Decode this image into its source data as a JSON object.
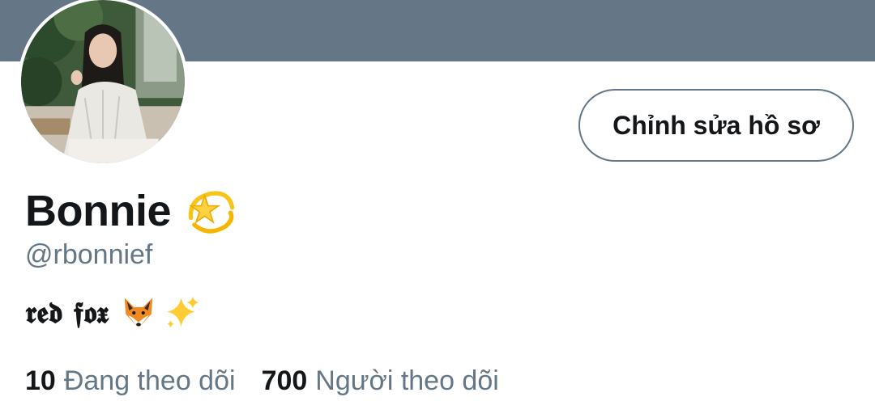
{
  "profile": {
    "display_name": "Bonnie",
    "handle": "@rbonnief",
    "bio_text": "𝖗𝖊𝖉 𝖋𝖔𝖝",
    "edit_button_label": "Chỉnh sửa hồ sơ",
    "name_emoji": "dizzy-icon",
    "bio_icons": [
      "fox-icon",
      "sparkles-icon"
    ]
  },
  "stats": {
    "following_count": "10",
    "following_label": "Đang theo dõi",
    "followers_count": "700",
    "followers_label": "Người theo dõi"
  },
  "colors": {
    "banner": "#657786",
    "text_primary": "#14171a",
    "text_secondary": "#657786"
  }
}
